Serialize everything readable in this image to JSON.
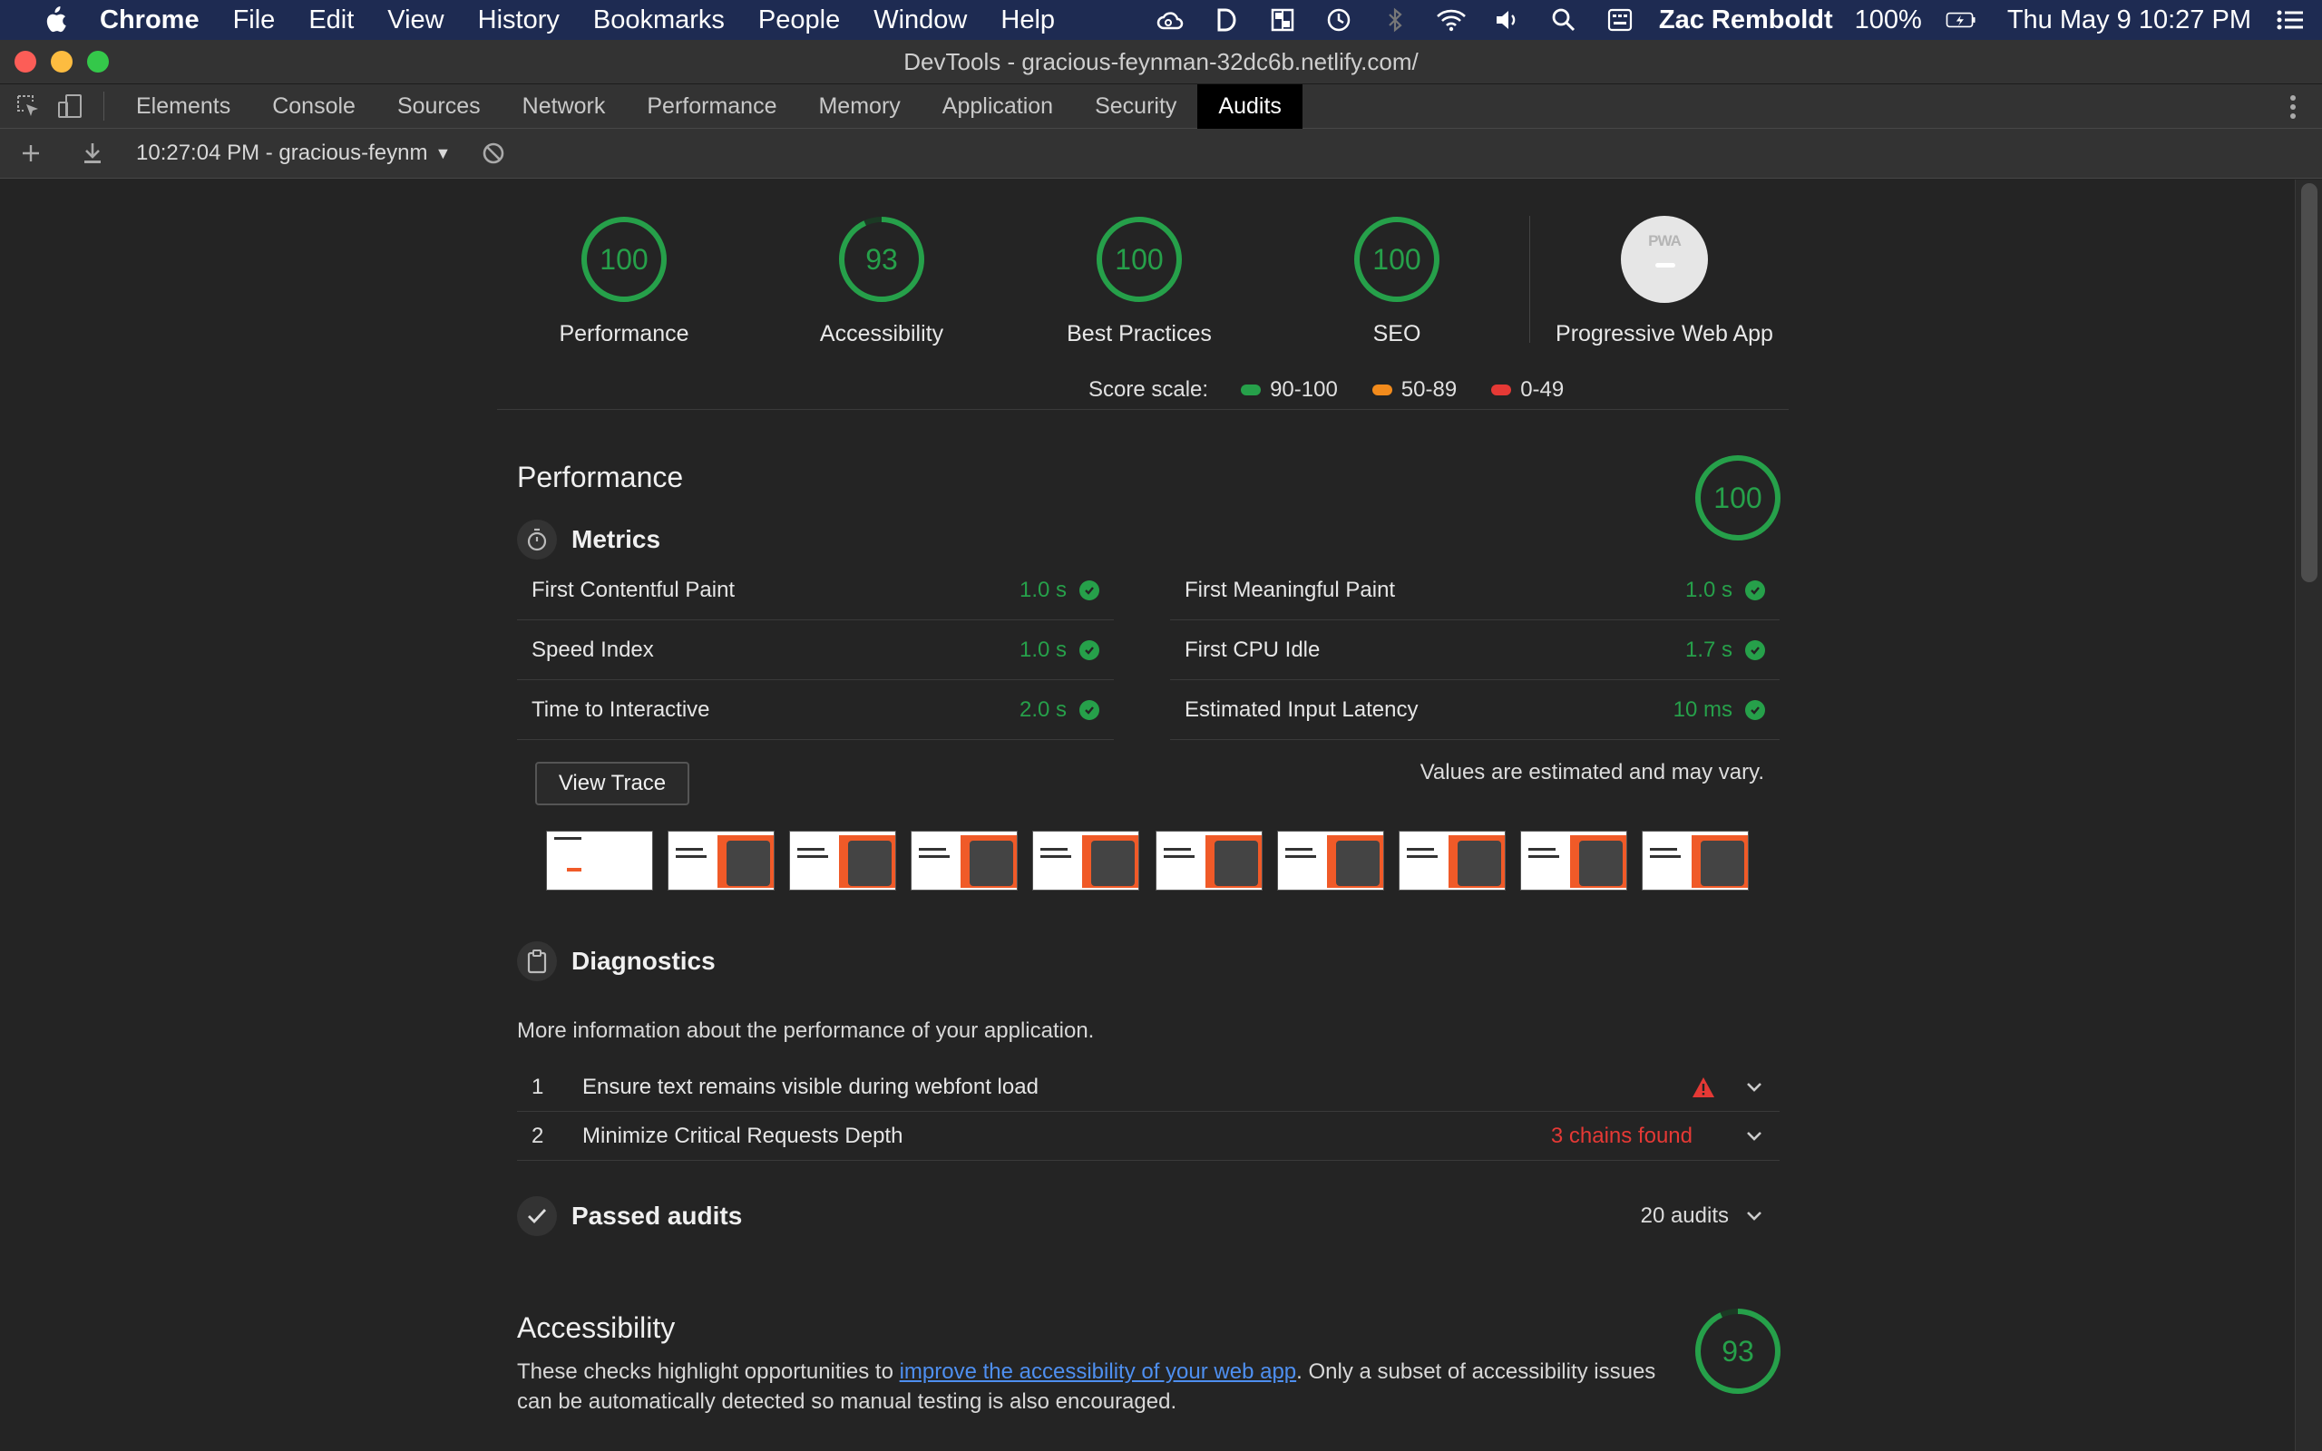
{
  "menubar": {
    "app": "Chrome",
    "items": [
      "File",
      "Edit",
      "View",
      "History",
      "Bookmarks",
      "People",
      "Window",
      "Help"
    ],
    "user": "Zac Remboldt",
    "battery": "100%",
    "clock": "Thu May 9  10:27 PM"
  },
  "window": {
    "title": "DevTools - gracious-feynman-32dc6b.netlify.com/"
  },
  "devtools": {
    "tabs": [
      "Elements",
      "Console",
      "Sources",
      "Network",
      "Performance",
      "Memory",
      "Application",
      "Security",
      "Audits"
    ],
    "active_tab": "Audits"
  },
  "audits_toolbar": {
    "report": "10:27:04 PM - gracious-feynm"
  },
  "summary": {
    "gauges": [
      {
        "score": "100",
        "label": "Performance",
        "fraction": 1.0
      },
      {
        "score": "93",
        "label": "Accessibility",
        "fraction": 0.93
      },
      {
        "score": "100",
        "label": "Best Practices",
        "fraction": 1.0
      },
      {
        "score": "100",
        "label": "SEO",
        "fraction": 1.0
      }
    ],
    "pwa": {
      "badge": "PWA",
      "label": "Progressive Web App"
    },
    "scale": {
      "label": "Score scale:",
      "ranges": [
        {
          "text": "90-100",
          "color": "#26a04a"
        },
        {
          "text": "50-89",
          "color": "#f28b1c"
        },
        {
          "text": "0-49",
          "color": "#e53935"
        }
      ]
    }
  },
  "performance": {
    "title": "Performance",
    "score": "100",
    "metrics_title": "Metrics",
    "metrics": [
      {
        "name": "First Contentful Paint",
        "value": "1.0 s"
      },
      {
        "name": "First Meaningful Paint",
        "value": "1.0 s"
      },
      {
        "name": "Speed Index",
        "value": "1.0 s"
      },
      {
        "name": "First CPU Idle",
        "value": "1.7 s"
      },
      {
        "name": "Time to Interactive",
        "value": "2.0 s"
      },
      {
        "name": "Estimated Input Latency",
        "value": "10 ms"
      }
    ],
    "view_trace": "View Trace",
    "estimated_note": "Values are estimated and may vary.",
    "diagnostics_title": "Diagnostics",
    "diagnostics_desc": "More information about the performance of your application.",
    "diagnostics": [
      {
        "index": "1",
        "name": "Ensure text remains visible during webfont load",
        "value": ""
      },
      {
        "index": "2",
        "name": "Minimize Critical Requests Depth",
        "value": "3 chains found"
      }
    ],
    "passed_title": "Passed audits",
    "passed_count": "20 audits"
  },
  "accessibility": {
    "title": "Accessibility",
    "score": "93",
    "fraction": 0.93,
    "desc_before": "These checks highlight opportunities to ",
    "desc_link": "improve the accessibility of your web app",
    "desc_after": ". Only a subset of accessibility issues can be automatically detected so manual testing is also encouraged."
  },
  "colors": {
    "pass": "#26a04a",
    "fail": "#e53935",
    "link": "#4e8ff0",
    "menubar": "#1e2b52"
  }
}
